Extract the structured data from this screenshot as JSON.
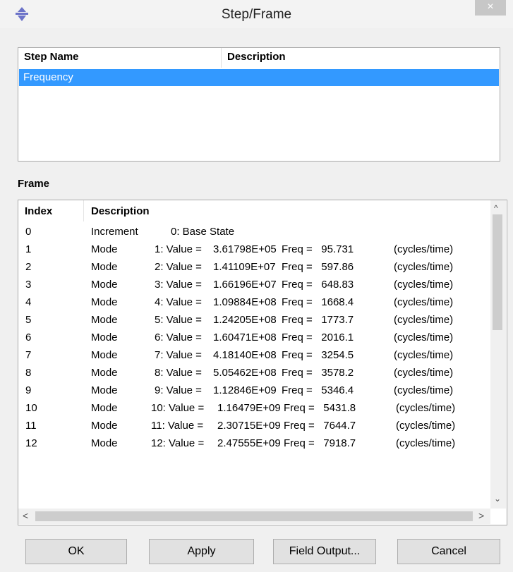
{
  "window": {
    "title": "Step/Frame",
    "close_glyph": "×"
  },
  "step_table": {
    "columns": [
      "Step Name",
      "Description"
    ],
    "rows": [
      {
        "name": "Frequency",
        "description": ""
      }
    ]
  },
  "frame_section": {
    "label": "Frame",
    "columns": [
      "Index",
      "Description"
    ],
    "rows": [
      {
        "index": "0",
        "type": "Increment",
        "mode": "0: Base State",
        "value": "",
        "freq": "",
        "unit": ""
      },
      {
        "index": "1",
        "type": "Mode",
        "mode": "1: Value =",
        "value": "3.61798E+05",
        "freq": "Freq =   95.731",
        "unit": "(cycles/time)"
      },
      {
        "index": "2",
        "type": "Mode",
        "mode": "2: Value =",
        "value": "1.41109E+07",
        "freq": "Freq =   597.86",
        "unit": "(cycles/time)"
      },
      {
        "index": "3",
        "type": "Mode",
        "mode": "3: Value =",
        "value": "1.66196E+07",
        "freq": "Freq =   648.83",
        "unit": "(cycles/time)"
      },
      {
        "index": "4",
        "type": "Mode",
        "mode": "4: Value =",
        "value": "1.09884E+08",
        "freq": "Freq =   1668.4",
        "unit": "(cycles/time)"
      },
      {
        "index": "5",
        "type": "Mode",
        "mode": "5: Value =",
        "value": "1.24205E+08",
        "freq": "Freq =   1773.7",
        "unit": "(cycles/time)"
      },
      {
        "index": "6",
        "type": "Mode",
        "mode": "6: Value =",
        "value": "1.60471E+08",
        "freq": "Freq =   2016.1",
        "unit": "(cycles/time)"
      },
      {
        "index": "7",
        "type": "Mode",
        "mode": "7: Value =",
        "value": "4.18140E+08",
        "freq": "Freq =   3254.5",
        "unit": "(cycles/time)"
      },
      {
        "index": "8",
        "type": "Mode",
        "mode": "8: Value =",
        "value": "5.05462E+08",
        "freq": "Freq =   3578.2",
        "unit": "(cycles/time)"
      },
      {
        "index": "9",
        "type": "Mode",
        "mode": "9: Value =",
        "value": "1.12846E+09",
        "freq": "Freq =   5346.4",
        "unit": "(cycles/time)"
      },
      {
        "index": "10",
        "type": "Mode",
        "mode": "10: Value =",
        "value": "1.16479E+09",
        "freq": "Freq =   5431.8",
        "unit": "(cycles/time)"
      },
      {
        "index": "11",
        "type": "Mode",
        "mode": "11: Value =",
        "value": "2.30715E+09",
        "freq": "Freq =   7644.7",
        "unit": "(cycles/time)"
      },
      {
        "index": "12",
        "type": "Mode",
        "mode": "12: Value =",
        "value": "2.47555E+09",
        "freq": "Freq =   7918.7",
        "unit": "(cycles/time)"
      }
    ]
  },
  "scroll_glyphs": {
    "up": "^",
    "down": "⌄",
    "left": "<",
    "right": ">"
  },
  "buttons": {
    "ok": "OK",
    "apply": "Apply",
    "field_output": "Field Output...",
    "cancel": "Cancel"
  },
  "colors": {
    "selection": "#3399ff",
    "icon_accent": "#6b72c8"
  }
}
